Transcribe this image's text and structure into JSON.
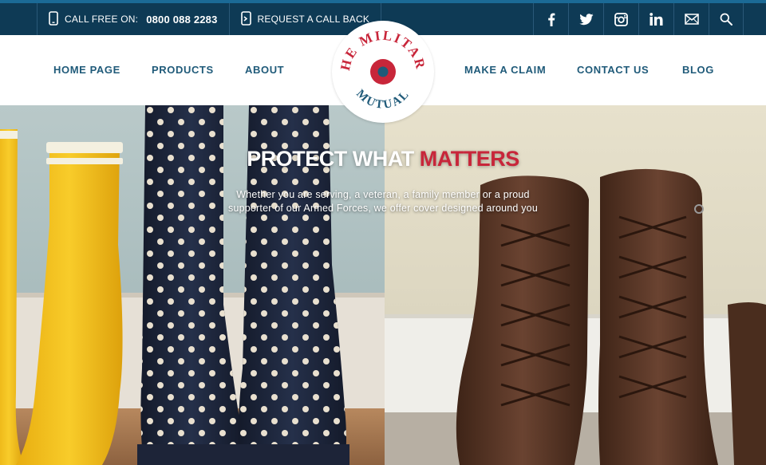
{
  "topbar": {
    "call_label": "CALL FREE ON:",
    "call_number": "0800 088 2283",
    "callback_label": "REQUEST A CALL BACK",
    "social": [
      "facebook-icon",
      "twitter-icon",
      "instagram-icon",
      "linkedin-icon",
      "email-icon",
      "search-icon"
    ]
  },
  "nav": {
    "home": "HOME PAGE",
    "products": "PRODUCTS",
    "about": "ABOUT",
    "claim": "MAKE A CLAIM",
    "contact": "CONTACT US",
    "blog": "BLOG"
  },
  "logo": {
    "top_text": "THE MILITARY",
    "bottom_text": "MUTUAL"
  },
  "hero": {
    "title_white": "PROTECT WHAT",
    "title_red": "MATTERS",
    "subtitle": "Whether you are serving, a veteran, a family member or a proud supporter of our Armed Forces, we offer cover designed around you"
  },
  "colors": {
    "topbar": "#0e3a55",
    "nav_text": "#1f5a79",
    "accent_red": "#c8263a",
    "logo_blue": "#1f5a79"
  }
}
